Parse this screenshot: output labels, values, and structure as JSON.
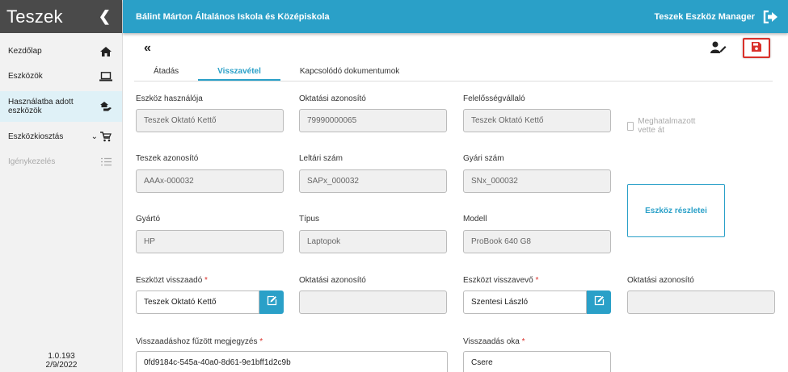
{
  "sidebar": {
    "brand": "Teszek",
    "items": [
      {
        "label": "Kezdőlap"
      },
      {
        "label": "Eszközök"
      },
      {
        "label": "Használatba adott eszközök"
      },
      {
        "label": "Eszközkiosztás"
      },
      {
        "label": "Igénykezelés"
      }
    ],
    "version": "1.0.193",
    "date": "2/9/2022"
  },
  "header": {
    "school": "Bálint Márton Általános Iskola és Középiskola",
    "manager": "Teszek Eszköz Manager"
  },
  "tabs": [
    {
      "label": "Átadás"
    },
    {
      "label": "Visszavétel"
    },
    {
      "label": "Kapcsolódó dokumentumok"
    }
  ],
  "form": {
    "row1": {
      "user_label": "Eszköz használója",
      "user_value": "Teszek Oktató Kettő",
      "edu_id_label": "Oktatási azonosító",
      "edu_id_value": "79990000065",
      "resp_label": "Felelősségvállaló",
      "resp_value": "Teszek Oktató Kettő",
      "checkbox_label": "Meghatalmazott vette át"
    },
    "row2": {
      "teszek_id_label": "Teszek azonosító",
      "teszek_id_value": "AAAx-000032",
      "inventory_label": "Leltári szám",
      "inventory_value": "SAPx_000032",
      "serial_label": "Gyári szám",
      "serial_value": "SNx_000032"
    },
    "details_button": "Eszköz részletei",
    "row3": {
      "maker_label": "Gyártó",
      "maker_value": "HP",
      "type_label": "Típus",
      "type_value": "Laptopok",
      "model_label": "Modell",
      "model_value": "ProBook 640 G8"
    },
    "row4": {
      "returner_label": "Eszközt visszaadó",
      "returner_value": "Teszek Oktató Kettő",
      "returner_edu_label": "Oktatási azonosító",
      "returner_edu_value": "",
      "receiver_label": "Eszközt visszavevő",
      "receiver_value": "Szentesi László",
      "receiver_edu_label": "Oktatási azonosító",
      "receiver_edu_value": ""
    },
    "row5": {
      "note_label": "Visszaadáshoz fűzött megjegyzés",
      "note_value": "0fd9184c-545a-40a0-8d61-9e1bff1d2c9b",
      "reason_label": "Visszaadás oka",
      "reason_value": "Csere"
    },
    "required_marker": "*"
  },
  "colors": {
    "accent": "#2aa0c8",
    "danger": "#d9302a",
    "sidebar_header": "#4a4a4a"
  },
  "icons": [
    "home-icon",
    "laptop-icon",
    "device-hand-icon",
    "cart-icon",
    "list-icon",
    "logout-icon",
    "user-edit-icon",
    "save-icon",
    "pencil-icon",
    "double-chevron-left-icon"
  ]
}
